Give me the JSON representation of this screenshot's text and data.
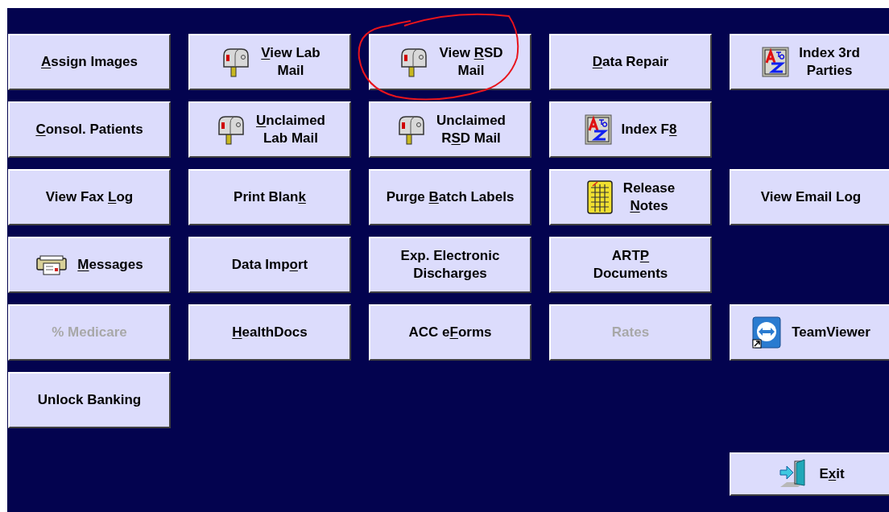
{
  "rows": [
    [
      {
        "label": [
          {
            "text": "A",
            "underlined": true
          },
          {
            "text": "ssign Images",
            "underlined": false
          }
        ],
        "disabled": false
      },
      {
        "kind": "mailbox",
        "label": [
          {
            "text": "V",
            "underlined": true
          },
          {
            "text": "iew Lab\nMail",
            "underlined": false
          }
        ],
        "disabled": false
      },
      {
        "kind": "mailbox",
        "circled": true,
        "label": [
          {
            "text": "View ",
            "underlined": false
          },
          {
            "text": "R",
            "underlined": true
          },
          {
            "text": "SD\nMail",
            "underlined": false
          }
        ],
        "disabled": false
      },
      {
        "label": [
          {
            "text": "D",
            "underlined": true
          },
          {
            "text": "ata Repair",
            "underlined": false
          }
        ],
        "disabled": false
      },
      {
        "kind": "a-to-z",
        "label": [
          {
            "text": "Index 3rd\nParties",
            "underlined": false
          }
        ],
        "disabled": false
      }
    ],
    [
      {
        "label": [
          {
            "text": "C",
            "underlined": true
          },
          {
            "text": "onsol. Patients",
            "underlined": false
          }
        ],
        "disabled": false
      },
      {
        "kind": "mailbox",
        "label": [
          {
            "text": "U",
            "underlined": true
          },
          {
            "text": "nclaimed\nLab Mail",
            "underlined": false
          }
        ],
        "disabled": false
      },
      {
        "kind": "mailbox",
        "label": [
          {
            "text": "Unclaimed\nR",
            "underlined": false
          },
          {
            "text": "S",
            "underlined": true
          },
          {
            "text": "D Mail",
            "underlined": false
          }
        ],
        "disabled": false
      },
      {
        "kind": "a-to-z",
        "label": [
          {
            "text": "Index F",
            "underlined": false
          },
          {
            "text": "8",
            "underlined": true
          }
        ],
        "disabled": false
      },
      null
    ],
    [
      {
        "label": [
          {
            "text": "View Fax ",
            "underlined": false
          },
          {
            "text": "L",
            "underlined": true
          },
          {
            "text": "og",
            "underlined": false
          }
        ],
        "disabled": false
      },
      {
        "label": [
          {
            "text": "Print Blan",
            "underlined": false
          },
          {
            "text": "k",
            "underlined": true
          }
        ],
        "disabled": false
      },
      {
        "label": [
          {
            "text": "Purge ",
            "underlined": false
          },
          {
            "text": "B",
            "underlined": true
          },
          {
            "text": "atch Labels",
            "underlined": false
          }
        ],
        "disabled": false
      },
      {
        "kind": "notebook",
        "label": [
          {
            "text": "Release\n",
            "underlined": false
          },
          {
            "text": "N",
            "underlined": true
          },
          {
            "text": "otes",
            "underlined": false
          }
        ],
        "disabled": false
      },
      {
        "label": [
          {
            "text": "View Email Log",
            "underlined": false
          }
        ],
        "disabled": false
      }
    ],
    [
      {
        "kind": "fax",
        "label": [
          {
            "text": "M",
            "underlined": true
          },
          {
            "text": "essages",
            "underlined": false
          }
        ],
        "disabled": false
      },
      {
        "label": [
          {
            "text": "Data Imp",
            "underlined": false
          },
          {
            "text": "o",
            "underlined": true
          },
          {
            "text": "rt",
            "underlined": false
          }
        ],
        "disabled": false
      },
      {
        "label": [
          {
            "text": "Exp. Electronic\nDischarges",
            "underlined": false
          }
        ],
        "disabled": false
      },
      {
        "label": [
          {
            "text": "ART",
            "underlined": false
          },
          {
            "text": "P",
            "underlined": true
          },
          {
            "text": "\nDocuments",
            "underlined": false
          }
        ],
        "disabled": false
      },
      null
    ],
    [
      {
        "label": [
          {
            "text": "% Medicare",
            "underlined": false
          }
        ],
        "disabled": true
      },
      {
        "label": [
          {
            "text": "H",
            "underlined": true
          },
          {
            "text": "ealthDocs",
            "underlined": false
          }
        ],
        "disabled": false
      },
      {
        "label": [
          {
            "text": "ACC e",
            "underlined": false
          },
          {
            "text": "F",
            "underlined": true
          },
          {
            "text": "orms",
            "underlined": false
          }
        ],
        "disabled": false
      },
      {
        "label": [
          {
            "text": "Rates",
            "underlined": false
          }
        ],
        "disabled": true
      },
      {
        "kind": "teamviewer",
        "label": [
          {
            "text": "TeamViewer",
            "underlined": false
          }
        ],
        "disabled": false
      }
    ],
    [
      {
        "label": [
          {
            "text": "Unlock Banking",
            "underlined": false
          }
        ],
        "disabled": false
      },
      null,
      null,
      null,
      null
    ],
    [
      null,
      null,
      null,
      null,
      {
        "kind": "exit",
        "label": [
          {
            "text": "E",
            "underlined": false
          },
          {
            "text": "x",
            "underlined": true
          },
          {
            "text": "it",
            "underlined": false
          }
        ],
        "disabled": false
      }
    ]
  ],
  "annotation": {
    "kind": "ellipse",
    "color": "#e8141c"
  }
}
